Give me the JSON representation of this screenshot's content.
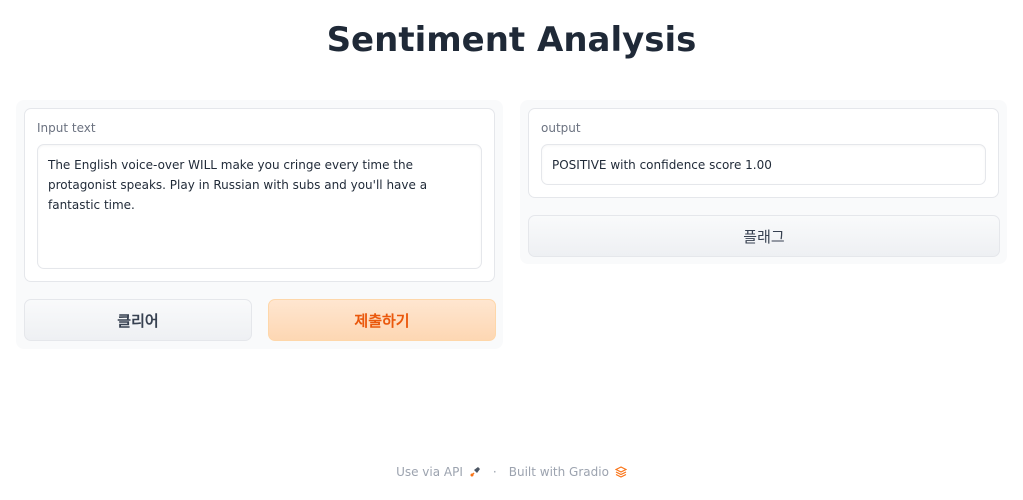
{
  "app": {
    "title": "Sentiment Analysis"
  },
  "input": {
    "label": "Input text",
    "value": "The English voice-over WILL make you cringe every time the protagonist speaks. Play in Russian with subs and you'll have a fantastic time."
  },
  "buttons": {
    "clear": "클리어",
    "submit": "제출하기",
    "flag": "플래그"
  },
  "output": {
    "label": "output",
    "value": "POSITIVE with confidence score 1.00"
  },
  "footer": {
    "api_link": "Use via API",
    "separator": "·",
    "built_with": "Built with Gradio"
  },
  "colors": {
    "accent": "#ea580c",
    "primary_button_bg": "#fdd7b3",
    "panel_bg": "#f9fafb"
  },
  "icons": {
    "api": "rocket-icon",
    "gradio": "gradio-logo-icon"
  }
}
